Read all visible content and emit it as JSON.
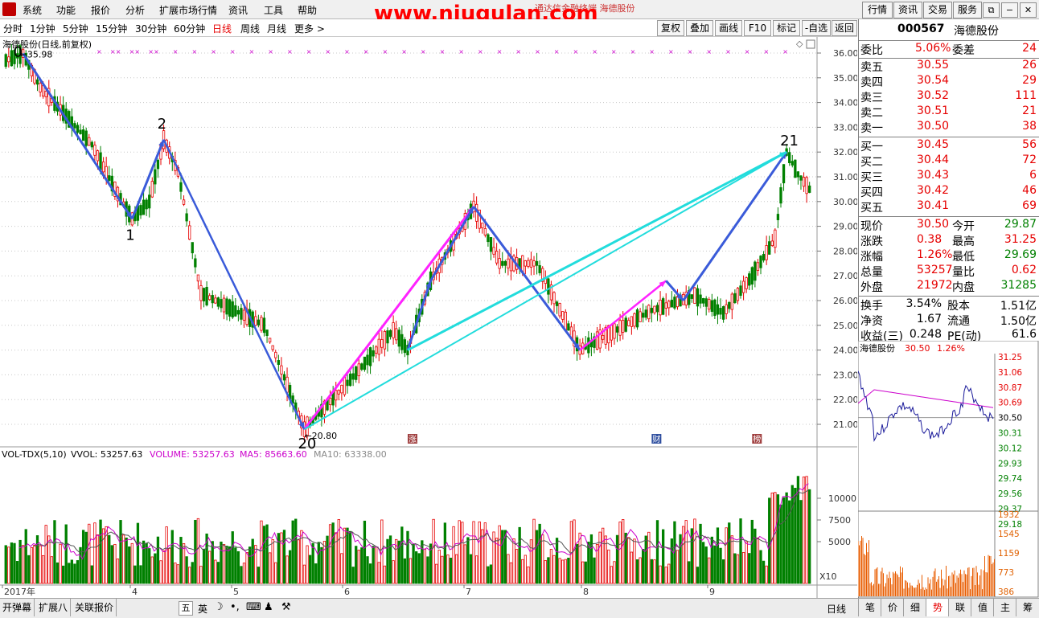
{
  "menu": [
    "系统",
    "功能",
    "报价",
    "分析",
    "扩展市场行情",
    "资讯",
    "工具",
    "帮助"
  ],
  "watermark": "www.niugulan.com",
  "watermark_sub": "通达信金融终端  海德股份",
  "top_buttons": [
    "行情",
    "资讯",
    "交易",
    "服务"
  ],
  "window_icons": [
    "⧉",
    "−",
    "✕"
  ],
  "periods": [
    "分时",
    "1分钟",
    "5分钟",
    "15分钟",
    "30分钟",
    "60分钟",
    "日线",
    "周线",
    "月线",
    "更多 >"
  ],
  "active_period": "日线",
  "tool_buttons": [
    "复权",
    "叠加",
    "画线",
    "F10",
    "标记",
    "-自选",
    "返回"
  ],
  "chart_title": "海德股份(日线,前复权)",
  "colors": {
    "up": "#e60000",
    "down": "#008000",
    "arrow": "#3a5bd9",
    "magenta": "#ff22ff",
    "cyan": "#22dcdc",
    "ma5": "#cc00cc"
  },
  "price_axis": [
    "36.00",
    "35.00",
    "34.00",
    "33.00",
    "32.00",
    "31.00",
    "30.00",
    "29.00",
    "28.00",
    "27.00",
    "26.00",
    "25.00",
    "24.00",
    "23.00",
    "22.00",
    "21.00"
  ],
  "annotations": {
    "high_label": "35.98",
    "low_label": "20.80",
    "points": [
      "0",
      "1",
      "2",
      "20",
      "21"
    ]
  },
  "event_badges": [
    "涨",
    "财",
    "榜"
  ],
  "volume_info": {
    "label": "VOL-TDX(5,10)",
    "vvol": "VVOL: 53257.63",
    "volume": "VOLUME: 53257.63",
    "ma5": "MA5: 85663.60",
    "ma10": "MA10: 63338.00"
  },
  "volume_axis": [
    "10000",
    "7500",
    "5000"
  ],
  "x10": "X10",
  "date_axis": [
    "2017年",
    "4",
    "5",
    "6",
    "7",
    "8",
    "9"
  ],
  "period_footer": "日线",
  "quote": {
    "code": "000567",
    "name": "海德股份",
    "weibi_label": "委比",
    "weibi": "5.06%",
    "weicha_label": "委差",
    "weicha": "24",
    "asks": [
      {
        "label": "卖五",
        "price": "30.55",
        "vol": "26"
      },
      {
        "label": "卖四",
        "price": "30.54",
        "vol": "29"
      },
      {
        "label": "卖三",
        "price": "30.52",
        "vol": "111"
      },
      {
        "label": "卖二",
        "price": "30.51",
        "vol": "21"
      },
      {
        "label": "卖一",
        "price": "30.50",
        "vol": "38"
      }
    ],
    "bids": [
      {
        "label": "买一",
        "price": "30.45",
        "vol": "56"
      },
      {
        "label": "买二",
        "price": "30.44",
        "vol": "72"
      },
      {
        "label": "买三",
        "price": "30.43",
        "vol": "6"
      },
      {
        "label": "买四",
        "price": "30.42",
        "vol": "46"
      },
      {
        "label": "买五",
        "price": "30.41",
        "vol": "69"
      }
    ],
    "stats": [
      {
        "l1": "现价",
        "v1": "30.50",
        "c1": "r",
        "l2": "今开",
        "v2": "29.87",
        "c2": "g"
      },
      {
        "l1": "涨跌",
        "v1": "0.38",
        "c1": "r",
        "l2": "最高",
        "v2": "31.25",
        "c2": "r"
      },
      {
        "l1": "涨幅",
        "v1": "1.26%",
        "c1": "r",
        "l2": "最低",
        "v2": "29.69",
        "c2": "g"
      },
      {
        "l1": "总量",
        "v1": "53257",
        "c1": "r",
        "l2": "量比",
        "v2": "0.62",
        "c2": "r"
      },
      {
        "l1": "外盘",
        "v1": "21972",
        "c1": "r",
        "l2": "内盘",
        "v2": "31285",
        "c2": "g"
      }
    ],
    "stats2": [
      {
        "l1": "换手",
        "v1": "3.54%",
        "l2": "股本",
        "v2": "1.51亿"
      },
      {
        "l1": "净资",
        "v1": "1.67",
        "l2": "流通",
        "v2": "1.50亿"
      },
      {
        "l1": "收益(三)",
        "v1": "0.248",
        "l2": "PE(动)",
        "v2": "61.6"
      }
    ]
  },
  "mini": {
    "name": "海德股份",
    "price": "30.50",
    "pct": "1.26%",
    "axis": [
      "31.25",
      "31.06",
      "30.87",
      "30.69",
      "30.50",
      "30.31",
      "30.12",
      "29.93",
      "29.74",
      "29.56",
      "29.37",
      "29.18"
    ],
    "vol_axis": [
      "1932",
      "1545",
      "1159",
      "773",
      "386"
    ]
  },
  "bottom_tabs": [
    "开弹幕",
    "扩展八",
    "关联报价"
  ],
  "tray": [
    "五",
    "英"
  ],
  "right_tabs": [
    "笔",
    "价",
    "细",
    "势",
    "联",
    "值",
    "主",
    "筹"
  ],
  "active_right_tab": "势",
  "chart_data": [
    {
      "type": "candlestick",
      "title": "海德股份(日线,前复权)",
      "ylim": [
        20.5,
        36.3
      ],
      "x_labels": [
        "2017年",
        "4",
        "5",
        "6",
        "7",
        "8",
        "9"
      ],
      "turning_points": [
        {
          "label": "0",
          "price": 35.98
        },
        {
          "label": "1",
          "price": 29.3
        },
        {
          "label": "2",
          "price": 32.5
        },
        {
          "label": "20",
          "price": 20.8
        },
        {
          "label": "21",
          "price": 32.0
        }
      ],
      "last": {
        "open": 29.87,
        "high": 31.25,
        "low": 29.69,
        "close": 30.5
      }
    },
    {
      "type": "bar",
      "title": "VOL-TDX(5,10)",
      "series": [
        {
          "name": "VOLUME",
          "last": 53257.63
        },
        {
          "name": "MA5",
          "last": 85663.6
        },
        {
          "name": "MA10",
          "last": 63338.0
        }
      ]
    }
  ]
}
